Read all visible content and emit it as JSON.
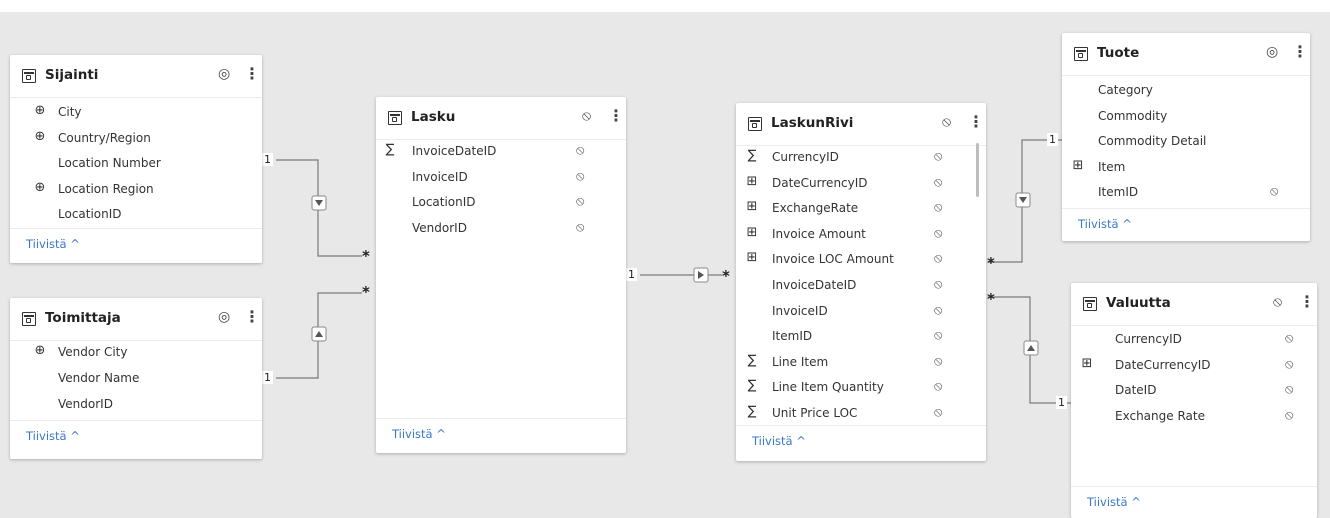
{
  "tables": {
    "sijainti": {
      "title": "Sijainti",
      "fields": [
        {
          "name": "City",
          "icon": "globe-icon"
        },
        {
          "name": "Country/Region",
          "icon": "globe-icon"
        },
        {
          "name": "Location Number",
          "icon": ""
        },
        {
          "name": "Location Region",
          "icon": "globe-icon"
        },
        {
          "name": "LocationID",
          "icon": ""
        }
      ],
      "collapse": "Tiivistä ^"
    },
    "toimittaja": {
      "title": "Toimittaja",
      "fields": [
        {
          "name": "Vendor City",
          "icon": "globe-icon"
        },
        {
          "name": "Vendor Name",
          "icon": ""
        },
        {
          "name": "VendorID",
          "icon": ""
        }
      ],
      "collapse": "Tiivistä ^"
    },
    "lasku": {
      "title": "Lasku",
      "fields": [
        {
          "name": "InvoiceDateID",
          "icon": "sigma-icon"
        },
        {
          "name": "InvoiceID",
          "icon": ""
        },
        {
          "name": "LocationID",
          "icon": ""
        },
        {
          "name": "VendorID",
          "icon": ""
        }
      ],
      "collapse": "Tiivistä ^"
    },
    "laskunrivi": {
      "title": "LaskunRivi",
      "fields": [
        {
          "name": "CurrencyID",
          "icon": "sigma-icon"
        },
        {
          "name": "DateCurrencyID",
          "icon": "calc-column-icon"
        },
        {
          "name": "ExchangeRate",
          "icon": "calc-column-icon"
        },
        {
          "name": "Invoice Amount",
          "icon": "calc-column-icon"
        },
        {
          "name": "Invoice LOC Amount",
          "icon": "calc-column-icon"
        },
        {
          "name": "InvoiceDateID",
          "icon": ""
        },
        {
          "name": "InvoiceID",
          "icon": ""
        },
        {
          "name": "ItemID",
          "icon": ""
        },
        {
          "name": "Line Item",
          "icon": "sigma-icon"
        },
        {
          "name": "Line Item Quantity",
          "icon": "sigma-icon"
        },
        {
          "name": "Unit Price LOC",
          "icon": "sigma-icon"
        }
      ],
      "collapse": "Tiivistä ^"
    },
    "tuote": {
      "title": "Tuote",
      "fields": [
        {
          "name": "Category",
          "icon": ""
        },
        {
          "name": "Commodity",
          "icon": ""
        },
        {
          "name": "Commodity Detail",
          "icon": ""
        },
        {
          "name": "Item",
          "icon": "calc-column-icon"
        },
        {
          "name": "ItemID",
          "icon": ""
        }
      ],
      "collapse": "Tiivistä ^"
    },
    "valuutta": {
      "title": "Valuutta",
      "fields": [
        {
          "name": "CurrencyID",
          "icon": ""
        },
        {
          "name": "DateCurrencyID",
          "icon": "calc-column-icon"
        },
        {
          "name": "DateID",
          "icon": ""
        },
        {
          "name": "Exchange Rate",
          "icon": ""
        }
      ],
      "collapse": "Tiivistä ^"
    }
  },
  "relationships": {
    "one": "1",
    "many": "*"
  },
  "icons": {
    "table": "table-icon",
    "visible": "eye-icon",
    "hidden": "eye-hidden-icon",
    "more": "more-options-icon"
  },
  "colors": {
    "canvas": "#e8e8e8",
    "link": "#3a78c9",
    "line": "#7a7a7a"
  }
}
